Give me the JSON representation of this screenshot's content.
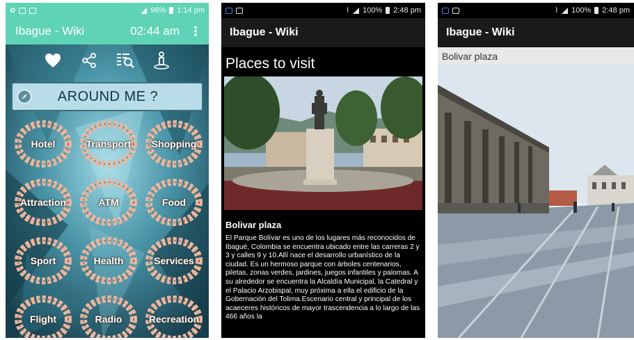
{
  "screen1": {
    "status": {
      "battery": "98%",
      "time": "1:14 pm"
    },
    "appbar": {
      "title": "Ibague - Wiki",
      "time": "02:44 am",
      "menu": "⋮"
    },
    "icons": [
      "heart-icon",
      "share-icon",
      "search-list-icon",
      "info-person-icon"
    ],
    "around_me": "AROUND ME ?",
    "categories": [
      {
        "label": "Hotel"
      },
      {
        "label": "Transport"
      },
      {
        "label": "Shopping"
      },
      {
        "label": "Attraction"
      },
      {
        "label": "ATM"
      },
      {
        "label": "Food"
      },
      {
        "label": "Sport"
      },
      {
        "label": "Health"
      },
      {
        "label": "Services"
      },
      {
        "label": "Flight"
      },
      {
        "label": "Radio"
      },
      {
        "label": "Recreation"
      }
    ],
    "colors": {
      "accent": "#5fd3b5",
      "background": "#1f5a6c"
    }
  },
  "screen2": {
    "status": {
      "battery": "100%",
      "time": "2:48 pm"
    },
    "appbar": {
      "title": "Ibague - Wiki"
    },
    "heading": "Places to visit",
    "place_name": "Bolivar plaza",
    "description": "El Parque Bolívar es uno de los lugares más reconocidos de Ibagué, Colombia se encuentra ubicado entre las carreras 2 y 3 y calles 9 y 10.Allí nace el desarrollo urbanístico de la ciudad. Es un hermoso parque con árboles centenarios, piletas, zonas verdes, jardines, juegos infantiles y palomas. A su alrededor se encuentra la Alcaldía Municipal, la Catedral y el Palacio Arzobispal, muy próxima a ella el edificio de la Gobernación del Tolima.Escenario central y principal de los acaeceres históricos de mayor trascendencia a lo largo de las 466 años la"
  },
  "screen3": {
    "status": {
      "battery": "100%",
      "time": "2:48 pm"
    },
    "appbar": {
      "title": "Ibague - Wiki"
    },
    "subtitle": "Bolivar plaza"
  }
}
